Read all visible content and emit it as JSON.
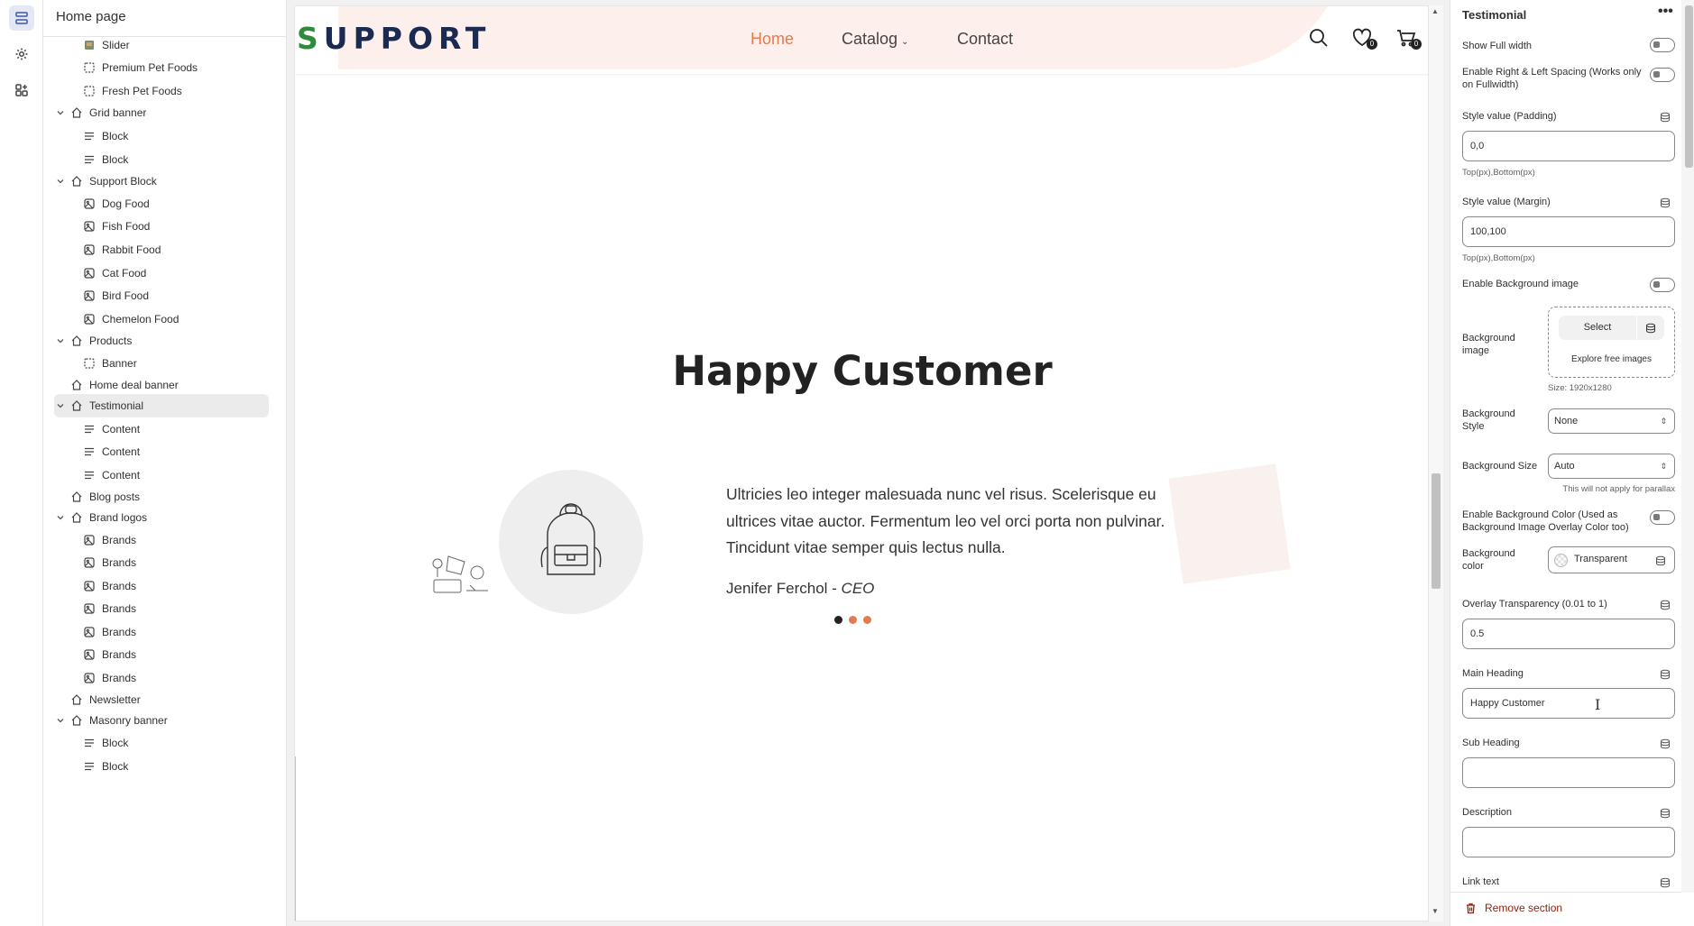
{
  "tree": {
    "title": "Home page",
    "rows": [
      {
        "label": "Slider",
        "level": "child",
        "icon": "slider-thumb-icon"
      },
      {
        "label": "Premium Pet Foods",
        "level": "child",
        "icon": "frame-icon"
      },
      {
        "label": "Fresh Pet Foods",
        "level": "child",
        "icon": "frame-icon"
      },
      {
        "label": "Grid banner",
        "level": "parent",
        "icon": "section-icon",
        "expanded": true
      },
      {
        "label": "Block",
        "level": "child",
        "icon": "text-lines-icon"
      },
      {
        "label": "Block",
        "level": "child",
        "icon": "text-lines-icon"
      },
      {
        "label": "Support Block",
        "level": "parent",
        "icon": "section-icon",
        "expanded": true
      },
      {
        "label": "Dog Food",
        "level": "child",
        "icon": "image-icon"
      },
      {
        "label": "Fish Food",
        "level": "child",
        "icon": "image-icon"
      },
      {
        "label": "Rabbit Food",
        "level": "child",
        "icon": "image-icon"
      },
      {
        "label": "Cat Food",
        "level": "child",
        "icon": "image-icon"
      },
      {
        "label": "Bird Food",
        "level": "child",
        "icon": "image-icon"
      },
      {
        "label": "Chemelon Food",
        "level": "child",
        "icon": "image-icon"
      },
      {
        "label": "Products",
        "level": "parent",
        "icon": "section-icon",
        "expanded": true
      },
      {
        "label": "Banner",
        "level": "child",
        "icon": "frame-icon"
      },
      {
        "label": "Home deal banner",
        "level": "parent",
        "icon": "section-icon",
        "expanded": false
      },
      {
        "label": "Testimonial",
        "level": "parent",
        "icon": "section-icon",
        "expanded": true,
        "selected": true
      },
      {
        "label": "Content",
        "level": "child",
        "icon": "text-lines-icon"
      },
      {
        "label": "Content",
        "level": "child",
        "icon": "text-lines-icon"
      },
      {
        "label": "Content",
        "level": "child",
        "icon": "text-lines-icon"
      },
      {
        "label": "Blog posts",
        "level": "parent",
        "icon": "section-icon",
        "expanded": false
      },
      {
        "label": "Brand logos",
        "level": "parent",
        "icon": "section-icon",
        "expanded": true
      },
      {
        "label": "Brands",
        "level": "child",
        "icon": "image-icon"
      },
      {
        "label": "Brands",
        "level": "child",
        "icon": "image-icon"
      },
      {
        "label": "Brands",
        "level": "child",
        "icon": "image-icon"
      },
      {
        "label": "Brands",
        "level": "child",
        "icon": "image-icon"
      },
      {
        "label": "Brands",
        "level": "child",
        "icon": "image-icon"
      },
      {
        "label": "Brands",
        "level": "child",
        "icon": "image-icon"
      },
      {
        "label": "Brands",
        "level": "child",
        "icon": "image-icon"
      },
      {
        "label": "Newsletter",
        "level": "parent",
        "icon": "section-icon",
        "expanded": false
      },
      {
        "label": "Masonry banner",
        "level": "parent",
        "icon": "section-icon",
        "expanded": true
      },
      {
        "label": "Block",
        "level": "child",
        "icon": "text-lines-icon"
      },
      {
        "label": "Block",
        "level": "child",
        "icon": "text-lines-icon"
      }
    ]
  },
  "preview": {
    "logo_first": "S",
    "logo_rest": "UPPORT",
    "nav": {
      "home": "Home",
      "catalog": "Catalog",
      "contact": "Contact"
    },
    "wishlist_count": "0",
    "cart_count": "0",
    "heading": "Happy Customer",
    "quote": "Ultricies leo integer malesuada nunc vel risus. Scelerisque eu ultrices vitae auctor. Fermentum leo vel orci porta non pulvinar. Tincidunt vitae semper quis lectus nulla.",
    "author_name": "Jenifer Ferchol - ",
    "author_role": "CEO",
    "accent_color": "#e37b4c"
  },
  "panel": {
    "title": "Testimonial",
    "show_full_width": "Show Full width",
    "enable_spacing": "Enable Right & Left Spacing (Works only on Fullwidth)",
    "padding_label": "Style value (Padding)",
    "padding_value": "0,0",
    "padding_hint": "Top(px),Bottom(px)",
    "margin_label": "Style value (Margin)",
    "margin_value": "100,100",
    "margin_hint": "Top(px),Bottom(px)",
    "enable_bg_image": "Enable Background image",
    "bg_image_label": "Background image",
    "bg_select": "Select",
    "bg_explore": "Explore free images",
    "bg_size_hint": "Size: 1920x1280",
    "bg_style_label": "Background Style",
    "bg_style_value": "None",
    "bg_size_label": "Background Size",
    "bg_size_value": "Auto",
    "parallax_hint": "This will not apply for parallax",
    "enable_bg_color": "Enable Background Color (Used as Background Image Overlay Color too)",
    "bg_color_label": "Background color",
    "bg_color_value": "Transparent",
    "overlay_label": "Overlay Transparency (0.01 to 1)",
    "overlay_value": "0.5",
    "main_heading_label": "Main Heading",
    "main_heading_value": "Happy Customer",
    "sub_heading_label": "Sub Heading",
    "sub_heading_value": "",
    "description_label": "Description",
    "description_value": "",
    "link_text_label": "Link text",
    "remove_section": "Remove section"
  }
}
